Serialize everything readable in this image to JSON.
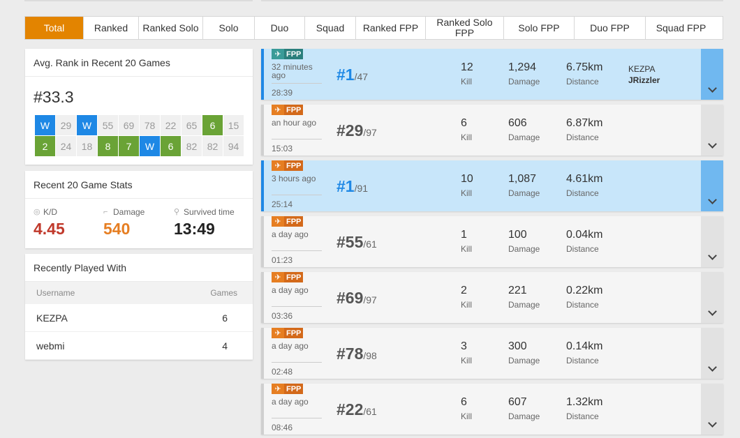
{
  "tabs": [
    "Total",
    "Ranked",
    "Ranked Solo",
    "Solo",
    "Duo",
    "Squad",
    "Ranked FPP",
    "Ranked Solo FPP",
    "Solo FPP",
    "Duo FPP",
    "Squad FPP"
  ],
  "active_tab": "Total",
  "avg_rank": {
    "title": "Avg. Rank in Recent 20 Games",
    "value": "#33.3",
    "cells": [
      {
        "label": "W",
        "kind": "win"
      },
      {
        "label": "29",
        "kind": "normal"
      },
      {
        "label": "W",
        "kind": "win"
      },
      {
        "label": "55",
        "kind": "normal"
      },
      {
        "label": "69",
        "kind": "normal"
      },
      {
        "label": "78",
        "kind": "normal"
      },
      {
        "label": "22",
        "kind": "normal"
      },
      {
        "label": "65",
        "kind": "normal"
      },
      {
        "label": "6",
        "kind": "top"
      },
      {
        "label": "15",
        "kind": "normal"
      },
      {
        "label": "2",
        "kind": "top"
      },
      {
        "label": "24",
        "kind": "normal"
      },
      {
        "label": "18",
        "kind": "normal"
      },
      {
        "label": "8",
        "kind": "top"
      },
      {
        "label": "7",
        "kind": "top"
      },
      {
        "label": "W",
        "kind": "win"
      },
      {
        "label": "6",
        "kind": "top"
      },
      {
        "label": "82",
        "kind": "normal"
      },
      {
        "label": "82",
        "kind": "normal"
      },
      {
        "label": "94",
        "kind": "normal"
      }
    ]
  },
  "recent_stats": {
    "title": "Recent 20 Game Stats",
    "kd": {
      "label": "K/D",
      "value": "4.45",
      "color": "#c0392b"
    },
    "damage": {
      "label": "Damage",
      "value": "540",
      "color": "#e67e22"
    },
    "survived": {
      "label": "Survived time",
      "value": "13:49",
      "color": "#222222"
    }
  },
  "played_with": {
    "title": "Recently Played With",
    "col_user": "Username",
    "col_games": "Games",
    "rows": [
      {
        "name": "KEZPA",
        "games": "6"
      },
      {
        "name": "webmi",
        "games": "4"
      }
    ]
  },
  "matches": [
    {
      "win": true,
      "mode": "FPP",
      "badge": "teal",
      "ago": "32 minutes ago",
      "duration": "28:39",
      "rank": "#1",
      "total": "/47",
      "kill": "12",
      "damage": "1,294",
      "distance": "6.75km",
      "players": [
        "KEZPA",
        "JRizzler"
      ]
    },
    {
      "win": false,
      "mode": "FPP",
      "badge": "orange",
      "ago": "an hour ago",
      "duration": "15:03",
      "rank": "#29",
      "total": "/97",
      "kill": "6",
      "damage": "606",
      "distance": "6.87km",
      "players": []
    },
    {
      "win": true,
      "mode": "FPP",
      "badge": "orange",
      "ago": "3 hours ago",
      "duration": "25:14",
      "rank": "#1",
      "total": "/91",
      "kill": "10",
      "damage": "1,087",
      "distance": "4.61km",
      "players": []
    },
    {
      "win": false,
      "mode": "FPP",
      "badge": "orange",
      "ago": "a day ago",
      "duration": "01:23",
      "rank": "#55",
      "total": "/61",
      "kill": "1",
      "damage": "100",
      "distance": "0.04km",
      "players": []
    },
    {
      "win": false,
      "mode": "FPP",
      "badge": "orange",
      "ago": "a day ago",
      "duration": "03:36",
      "rank": "#69",
      "total": "/97",
      "kill": "2",
      "damage": "221",
      "distance": "0.22km",
      "players": []
    },
    {
      "win": false,
      "mode": "FPP",
      "badge": "orange",
      "ago": "a day ago",
      "duration": "02:48",
      "rank": "#78",
      "total": "/98",
      "kill": "3",
      "damage": "300",
      "distance": "0.14km",
      "players": []
    },
    {
      "win": false,
      "mode": "FPP",
      "badge": "orange",
      "ago": "a day ago",
      "duration": "08:46",
      "rank": "#22",
      "total": "/61",
      "kill": "6",
      "damage": "607",
      "distance": "1.32km",
      "players": []
    }
  ],
  "labels": {
    "kill": "Kill",
    "damage": "Damage",
    "distance": "Distance"
  }
}
